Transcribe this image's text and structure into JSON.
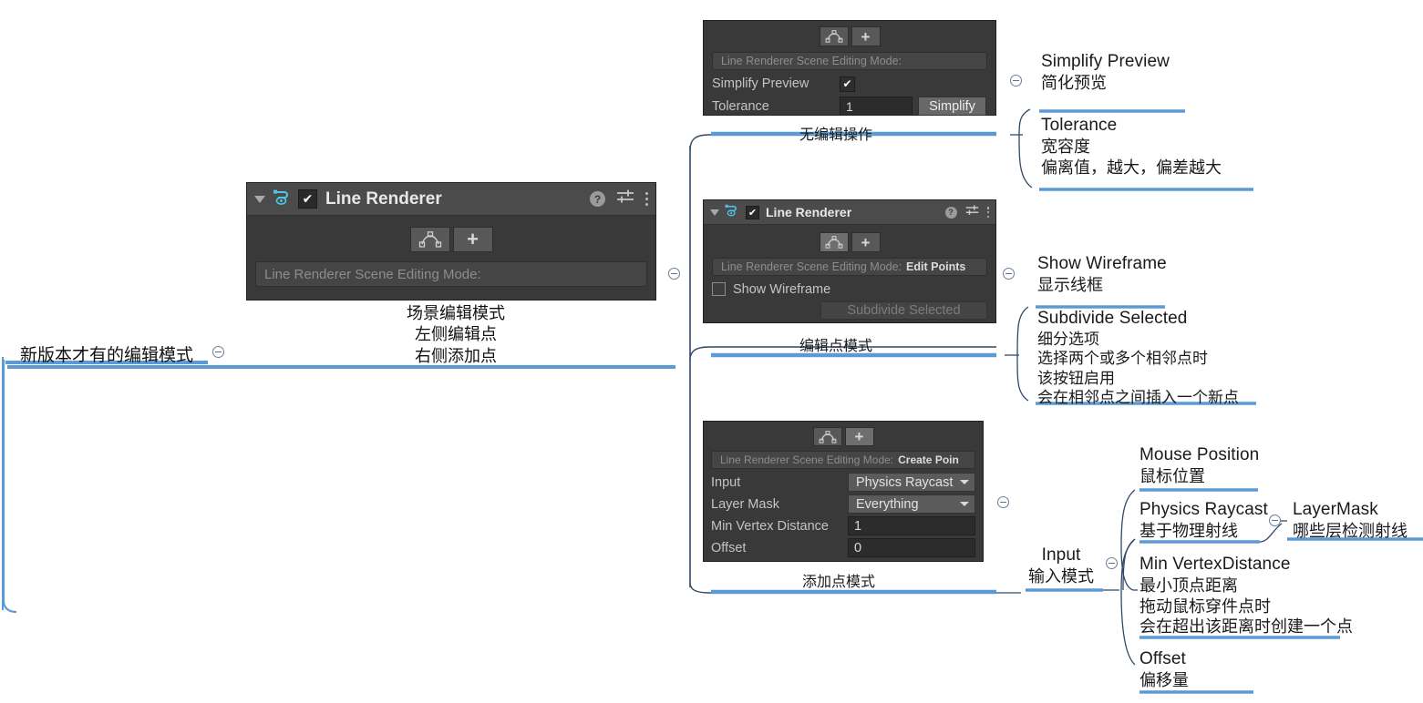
{
  "root": {
    "label": "新版本才有的编辑模式"
  },
  "main_panel": {
    "header": {
      "title": "Line Renderer",
      "foldout_icon": "triangle-down-icon",
      "component_icon": "line-renderer-icon",
      "enabled_checkbox": "✔",
      "help_icon": "?",
      "settings_icon": "settings-sliders-icon",
      "menu_icon": "kebab-menu-icon"
    },
    "tools": {
      "edit_points_icon": "edit-points-icon",
      "create_points_icon": "plus-icon"
    },
    "mode_bar": {
      "label": "Line Renderer Scene Editing Mode:",
      "value": ""
    },
    "caption_lines": [
      "场景编辑模式",
      "左侧编辑点",
      "右侧添加点"
    ]
  },
  "panel_no_edit": {
    "tools": {
      "edit_points_icon": "edit-points-icon",
      "create_points_icon": "plus-icon"
    },
    "mode_bar": {
      "label": "Line Renderer Scene Editing Mode:",
      "value": ""
    },
    "rows": [
      {
        "label": "Simplify Preview",
        "type": "checkbox",
        "checked": true,
        "mark": "✔"
      },
      {
        "label": "Tolerance",
        "type": "field",
        "value": "1",
        "button": "Simplify"
      }
    ],
    "caption": "无编辑操作"
  },
  "panel_edit_points": {
    "header": {
      "title": "Line Renderer",
      "enabled_checkbox": "✔",
      "help_icon": "?",
      "settings_icon": "settings-sliders-icon",
      "menu_icon": "kebab-menu-icon"
    },
    "mode_bar": {
      "label": "Line Renderer Scene Editing Mode:",
      "value": "Edit Points"
    },
    "rows": [
      {
        "label": "Show Wireframe",
        "type": "checkbox",
        "checked": false
      },
      {
        "label": "Subdivide Selected",
        "type": "button",
        "disabled": true
      }
    ],
    "caption": "编辑点模式"
  },
  "panel_create_points": {
    "mode_bar": {
      "label": "Line Renderer Scene Editing Mode:",
      "value": "Create Poin"
    },
    "rows": [
      {
        "label": "Input",
        "type": "dropdown",
        "value": "Physics Raycast"
      },
      {
        "label": "Layer Mask",
        "type": "dropdown",
        "value": "Everything"
      },
      {
        "label": "Min Vertex Distance",
        "type": "field",
        "value": "1"
      },
      {
        "label": "Offset",
        "type": "field",
        "value": "0"
      }
    ],
    "caption": "添加点模式"
  },
  "notes": {
    "simplify_preview": {
      "en": "Simplify Preview",
      "cn": [
        "简化预览"
      ]
    },
    "tolerance": {
      "en": "Tolerance",
      "cn": [
        "宽容度",
        "偏离值，越大，偏差越大"
      ]
    },
    "show_wireframe": {
      "en": "Show Wireframe",
      "cn": [
        "显示线框"
      ]
    },
    "subdivide_selected": {
      "en": "Subdivide Selected",
      "cn": [
        "细分选项",
        "选择两个或多个相邻点时",
        "该按钮启用",
        "会在相邻点之间插入一个新点"
      ]
    },
    "input": {
      "en": "Input",
      "cn": [
        "输入模式"
      ]
    },
    "mouse_position": {
      "en": "Mouse Position",
      "cn": [
        "鼠标位置"
      ]
    },
    "physics_raycast": {
      "en": "Physics Raycast",
      "cn": [
        "基于物理射线"
      ]
    },
    "layer_mask": {
      "en": "LayerMask",
      "cn": [
        "哪些层检测射线"
      ]
    },
    "min_vertex_distance": {
      "en": "Min VertexDistance",
      "cn": [
        "最小顶点距离",
        "拖动鼠标穿件点时",
        "会在超出该距离时创建一个点"
      ]
    },
    "offset": {
      "en": "Offset",
      "cn": [
        "偏移量"
      ]
    }
  },
  "colors": {
    "branch": "#5b9bd5",
    "connector": "#2f4a68",
    "panel_bg": "#393939",
    "panel_header": "#4b4b4b",
    "accent_cyan": "#4fc3e8"
  }
}
